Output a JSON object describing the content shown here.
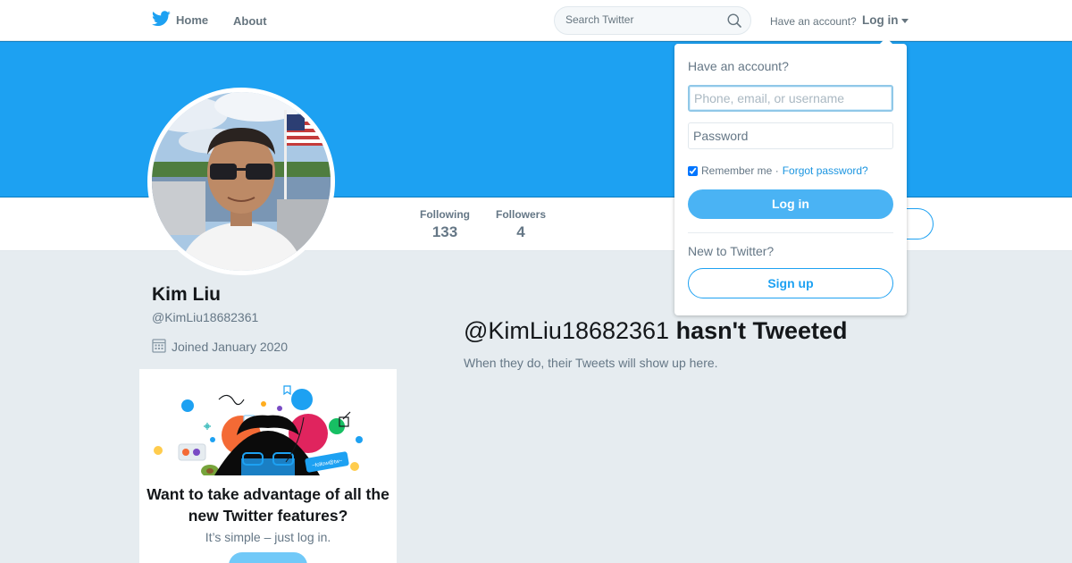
{
  "nav": {
    "home_label": "Home",
    "about_label": "About",
    "search_placeholder": "Search Twitter",
    "have_account": "Have an account?",
    "login_label": "Log in"
  },
  "profile": {
    "name": "Kim Liu",
    "handle": "@KimLiu18682361",
    "joined": "Joined January 2020",
    "stats": [
      {
        "label": "Following",
        "value": "133"
      },
      {
        "label": "Followers",
        "value": "4"
      }
    ]
  },
  "timeline": {
    "handle": "@KimLiu18682361",
    "title_suffix": "hasn't Tweeted",
    "subtitle": "When they do, their Tweets will show up here."
  },
  "promo": {
    "title": "Want to take advantage of all the new Twitter features?",
    "subtitle": "It’s simple – just log in.",
    "art_tag": "~follow@tw~"
  },
  "login_dropdown": {
    "title": "Have an account?",
    "username_placeholder": "Phone, email, or username",
    "password_placeholder": "Password",
    "remember_label": "Remember me ·",
    "remember_checked": true,
    "forgot_label": "Forgot password?",
    "login_button": "Log in",
    "new_to_twitter": "New to Twitter?",
    "signup_button": "Sign up"
  },
  "colors": {
    "brand_blue": "#1da1f2",
    "login_button": "#4ab3f4",
    "background": "#e6ecf0"
  },
  "icons": {
    "logo": "twitter-bird-icon",
    "search": "search-icon",
    "calendar": "calendar-icon",
    "caret": "caret-down-icon"
  }
}
